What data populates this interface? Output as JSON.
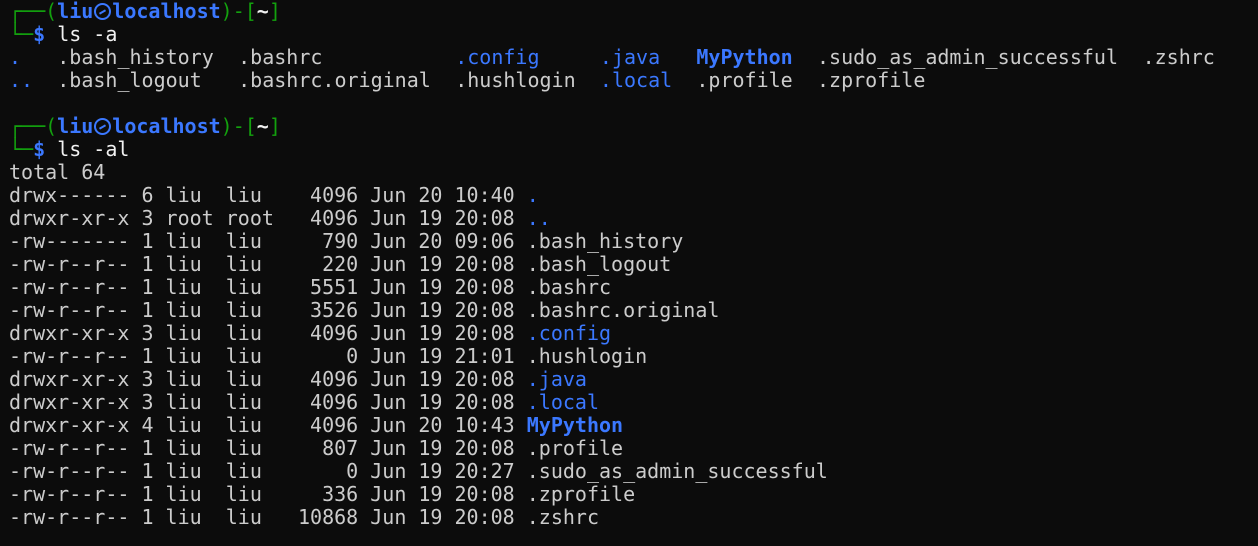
{
  "prompts": [
    {
      "user": "liu",
      "host": "localhost",
      "path": "~",
      "symbol": "$",
      "command": "ls -a"
    },
    {
      "user": "liu",
      "host": "localhost",
      "path": "~",
      "symbol": "$",
      "command": "ls -al"
    }
  ],
  "prompt_decor": {
    "top_left": "┌──(",
    "close_user": ")-[",
    "close_path": "]",
    "bottom_left": "└─"
  },
  "ls_a": {
    "row1": [
      ".",
      ".bash_history",
      ".bashrc",
      ".config",
      ".java",
      "MyPython",
      ".sudo_as_admin_successful",
      ".zshrc"
    ],
    "row2": [
      "..",
      ".bash_logout",
      ".bashrc.original",
      ".hushlogin",
      ".local",
      ".profile",
      ".zprofile"
    ]
  },
  "ls_al": {
    "total": "total 64",
    "rows": [
      {
        "perm": "drwx------",
        "links": "6",
        "owner": "liu",
        "group": "liu",
        "size": "4096",
        "date": "Jun 20 10:40",
        "name": ".",
        "dir": true
      },
      {
        "perm": "drwxr-xr-x",
        "links": "3",
        "owner": "root",
        "group": "root",
        "size": "4096",
        "date": "Jun 19 20:08",
        "name": "..",
        "dir": true
      },
      {
        "perm": "-rw-------",
        "links": "1",
        "owner": "liu",
        "group": "liu",
        "size": "790",
        "date": "Jun 20 09:06",
        "name": ".bash_history",
        "dir": false
      },
      {
        "perm": "-rw-r--r--",
        "links": "1",
        "owner": "liu",
        "group": "liu",
        "size": "220",
        "date": "Jun 19 20:08",
        "name": ".bash_logout",
        "dir": false
      },
      {
        "perm": "-rw-r--r--",
        "links": "1",
        "owner": "liu",
        "group": "liu",
        "size": "5551",
        "date": "Jun 19 20:08",
        "name": ".bashrc",
        "dir": false
      },
      {
        "perm": "-rw-r--r--",
        "links": "1",
        "owner": "liu",
        "group": "liu",
        "size": "3526",
        "date": "Jun 19 20:08",
        "name": ".bashrc.original",
        "dir": false
      },
      {
        "perm": "drwxr-xr-x",
        "links": "3",
        "owner": "liu",
        "group": "liu",
        "size": "4096",
        "date": "Jun 19 20:08",
        "name": ".config",
        "dir": true
      },
      {
        "perm": "-rw-r--r--",
        "links": "1",
        "owner": "liu",
        "group": "liu",
        "size": "0",
        "date": "Jun 19 21:01",
        "name": ".hushlogin",
        "dir": false
      },
      {
        "perm": "drwxr-xr-x",
        "links": "3",
        "owner": "liu",
        "group": "liu",
        "size": "4096",
        "date": "Jun 19 20:08",
        "name": ".java",
        "dir": true
      },
      {
        "perm": "drwxr-xr-x",
        "links": "3",
        "owner": "liu",
        "group": "liu",
        "size": "4096",
        "date": "Jun 19 20:08",
        "name": ".local",
        "dir": true
      },
      {
        "perm": "drwxr-xr-x",
        "links": "4",
        "owner": "liu",
        "group": "liu",
        "size": "4096",
        "date": "Jun 20 10:43",
        "name": "MyPython",
        "dir": true
      },
      {
        "perm": "-rw-r--r--",
        "links": "1",
        "owner": "liu",
        "group": "liu",
        "size": "807",
        "date": "Jun 19 20:08",
        "name": ".profile",
        "dir": false
      },
      {
        "perm": "-rw-r--r--",
        "links": "1",
        "owner": "liu",
        "group": "liu",
        "size": "0",
        "date": "Jun 19 20:27",
        "name": ".sudo_as_admin_successful",
        "dir": false
      },
      {
        "perm": "-rw-r--r--",
        "links": "1",
        "owner": "liu",
        "group": "liu",
        "size": "336",
        "date": "Jun 19 20:08",
        "name": ".zprofile",
        "dir": false
      },
      {
        "perm": "-rw-r--r--",
        "links": "1",
        "owner": "liu",
        "group": "liu",
        "size": "10868",
        "date": "Jun 19 20:08",
        "name": ".zshrc",
        "dir": false
      }
    ]
  },
  "colors": {
    "background": "#0c0c0c",
    "text": "#cccccc",
    "prompt_frame": "#13a10e",
    "user_host": "#3b78ff",
    "directory": "#3b78ff"
  },
  "icons": {
    "user_host_separator": "kali-skull-icon"
  }
}
